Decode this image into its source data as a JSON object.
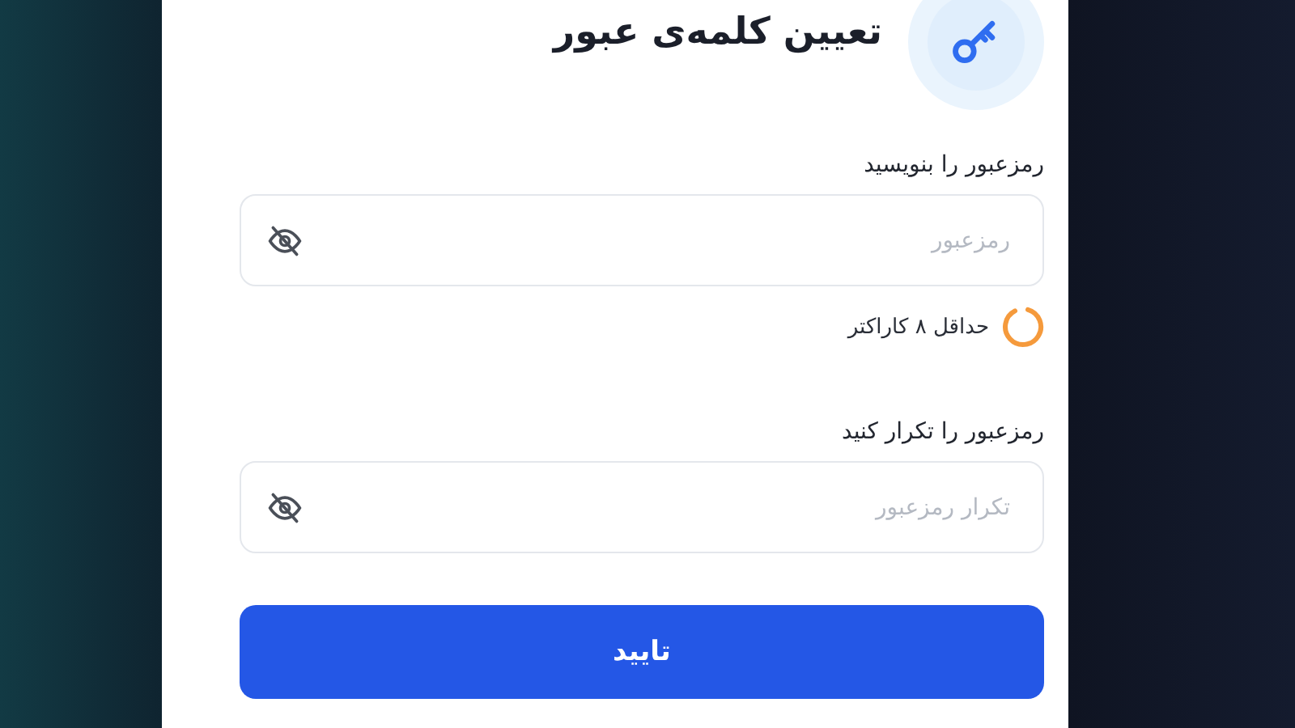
{
  "header": {
    "title": "تعیین کلمه‌ی عبور"
  },
  "fields": [
    {
      "label": "رمزعبور را بنویسید",
      "placeholder": "رمزعبور",
      "password_visible": false
    },
    {
      "label": "رمزعبور را تکرار کنید",
      "placeholder": "تکرار رمزعبور",
      "password_visible": false
    }
  ],
  "requirements": [
    {
      "text": "حداقل ۸ کاراکتر",
      "met": false
    }
  ],
  "submit_button": {
    "label": "تایید"
  }
}
